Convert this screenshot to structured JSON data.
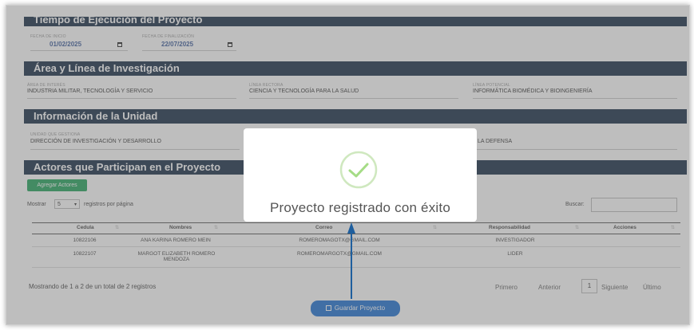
{
  "sections": {
    "tiempo": {
      "title": "Tiempo de Ejecución del Proyecto",
      "start_label": "Fecha de inicio",
      "start_value": "01/02/2025",
      "end_label": "Fecha de finalización",
      "end_value": "22/07/2025"
    },
    "area": {
      "title": "Área y Línea de Investigación",
      "f1_label": "Área de interés",
      "f1_value": "INDUSTRIA MILITAR, TECNOLOGÍA Y SERVICIO",
      "f2_label": "Línea rectora",
      "f2_value": "CIENCIA Y TECNOLOGÍA PARA LA SALUD",
      "f3_label": "Línea potencial",
      "f3_value": "INFORMÁTICA BIOMÉDICA Y BIOINGENIERÍA"
    },
    "unidad": {
      "title": "Información de la Unidad",
      "f1_label": "Unidad que gestiona",
      "f1_value": "DIRECCIÓN DE INVESTIGACIÓN Y DESARROLLO",
      "f3_value": "LA DEFENSA"
    },
    "actores": {
      "title": "Actores que Participan en el Proyecto",
      "add_button": "Agregar Actores",
      "show_prefix": "Mostrar",
      "page_size": "5",
      "show_suffix": "registros por página",
      "search_label": "Buscar:",
      "columns": [
        "Cedula",
        "Nombres",
        "Correo",
        "Responsabilidad",
        "Acciones"
      ],
      "rows": [
        {
          "cedula": "10822106",
          "nombres": "ANA KARINA ROMERO MEIN",
          "correo": "ROMEROMAGOTX@GMAIL.COM",
          "resp": "INVESTIGADOR"
        },
        {
          "cedula": "10822107",
          "nombres": "MARGOT ELIZABETH ROMERO MENDOZA",
          "correo": "ROMEROMARGOTX@GMAIL.COM",
          "resp": "LIDER"
        }
      ],
      "summary": "Mostrando de 1 a 2 de un total de 2 registros",
      "pagination": {
        "first": "Primero",
        "prev": "Anterior",
        "current": "1",
        "next": "Siguiente",
        "last": "Último"
      }
    }
  },
  "save_button": "Guardar Proyecto",
  "modal": {
    "title": "Proyecto registrado con éxito",
    "icon": "check-circle-icon",
    "icon_color": "#a5dc86"
  },
  "colors": {
    "header_bar": "#152a44",
    "add_button": "#20a35a",
    "save_button": "#1d6fd1",
    "annotation_arrow": "#1f5f9e"
  }
}
